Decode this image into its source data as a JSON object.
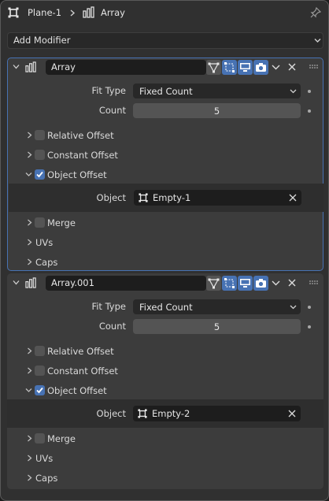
{
  "header": {
    "object_name": "Plane-1",
    "modifier_name": "Array",
    "icons": [
      "plane-object-icon",
      "modifier-wrench-icon",
      "pin-icon"
    ]
  },
  "add_modifier": {
    "label": "Add Modifier"
  },
  "colors": {
    "accent": "#4772b3",
    "panel": "#3c3c3c",
    "background": "#303030",
    "field": "#545454"
  },
  "modifiers": [
    {
      "name": "Array",
      "active": true,
      "fit_type_label": "Fit Type",
      "fit_type_value": "Fixed Count",
      "count_label": "Count",
      "count_value": "5",
      "relative_offset_label": "Relative Offset",
      "relative_offset_checked": false,
      "constant_offset_label": "Constant Offset",
      "constant_offset_checked": false,
      "object_offset_label": "Object Offset",
      "object_offset_checked": true,
      "object_label": "Object",
      "object_value": "Empty-1",
      "merge_label": "Merge",
      "merge_checked": false,
      "uvs_label": "UVs",
      "caps_label": "Caps"
    },
    {
      "name": "Array.001",
      "active": false,
      "fit_type_label": "Fit Type",
      "fit_type_value": "Fixed Count",
      "count_label": "Count",
      "count_value": "5",
      "relative_offset_label": "Relative Offset",
      "relative_offset_checked": false,
      "constant_offset_label": "Constant Offset",
      "constant_offset_checked": false,
      "object_offset_label": "Object Offset",
      "object_offset_checked": true,
      "object_label": "Object",
      "object_value": "Empty-2",
      "merge_label": "Merge",
      "merge_checked": false,
      "uvs_label": "UVs",
      "caps_label": "Caps"
    }
  ]
}
